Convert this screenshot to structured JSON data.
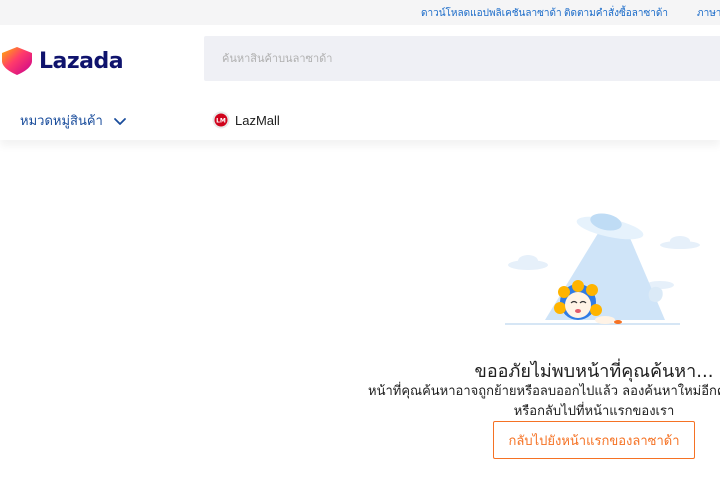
{
  "topbar": {
    "links": [
      "ดาวน์โหลดแอปพลิเคชันลาซาด้า",
      "ติดตามคำสั่งซื้อลาซาด้า",
      "ภาษา"
    ]
  },
  "header": {
    "logo_text": "Lazada",
    "search_placeholder": "ค้นหาสินค้าบนลาซาด้า"
  },
  "nav": {
    "categories_label": "หมวดหมู่สินค้า",
    "lazmall_label": "LazMall"
  },
  "empty_state": {
    "title": "ขออภัยไม่พบหน้าที่คุณค้นหา...",
    "description_line1": "หน้าที่คุณค้นหาอาจถูกย้ายหรือลบออกไปแล้ว ลองค้นหาใหม่อีกครั้ง",
    "description_line2": "หรือกลับไปที่หน้าแรกของเรา",
    "button_label": "กลับไปยังหน้าแรกของลาซาด้า"
  },
  "colors": {
    "accent": "#f57224",
    "brand_navy": "#0f136d",
    "link_blue": "#1a6bc9"
  }
}
